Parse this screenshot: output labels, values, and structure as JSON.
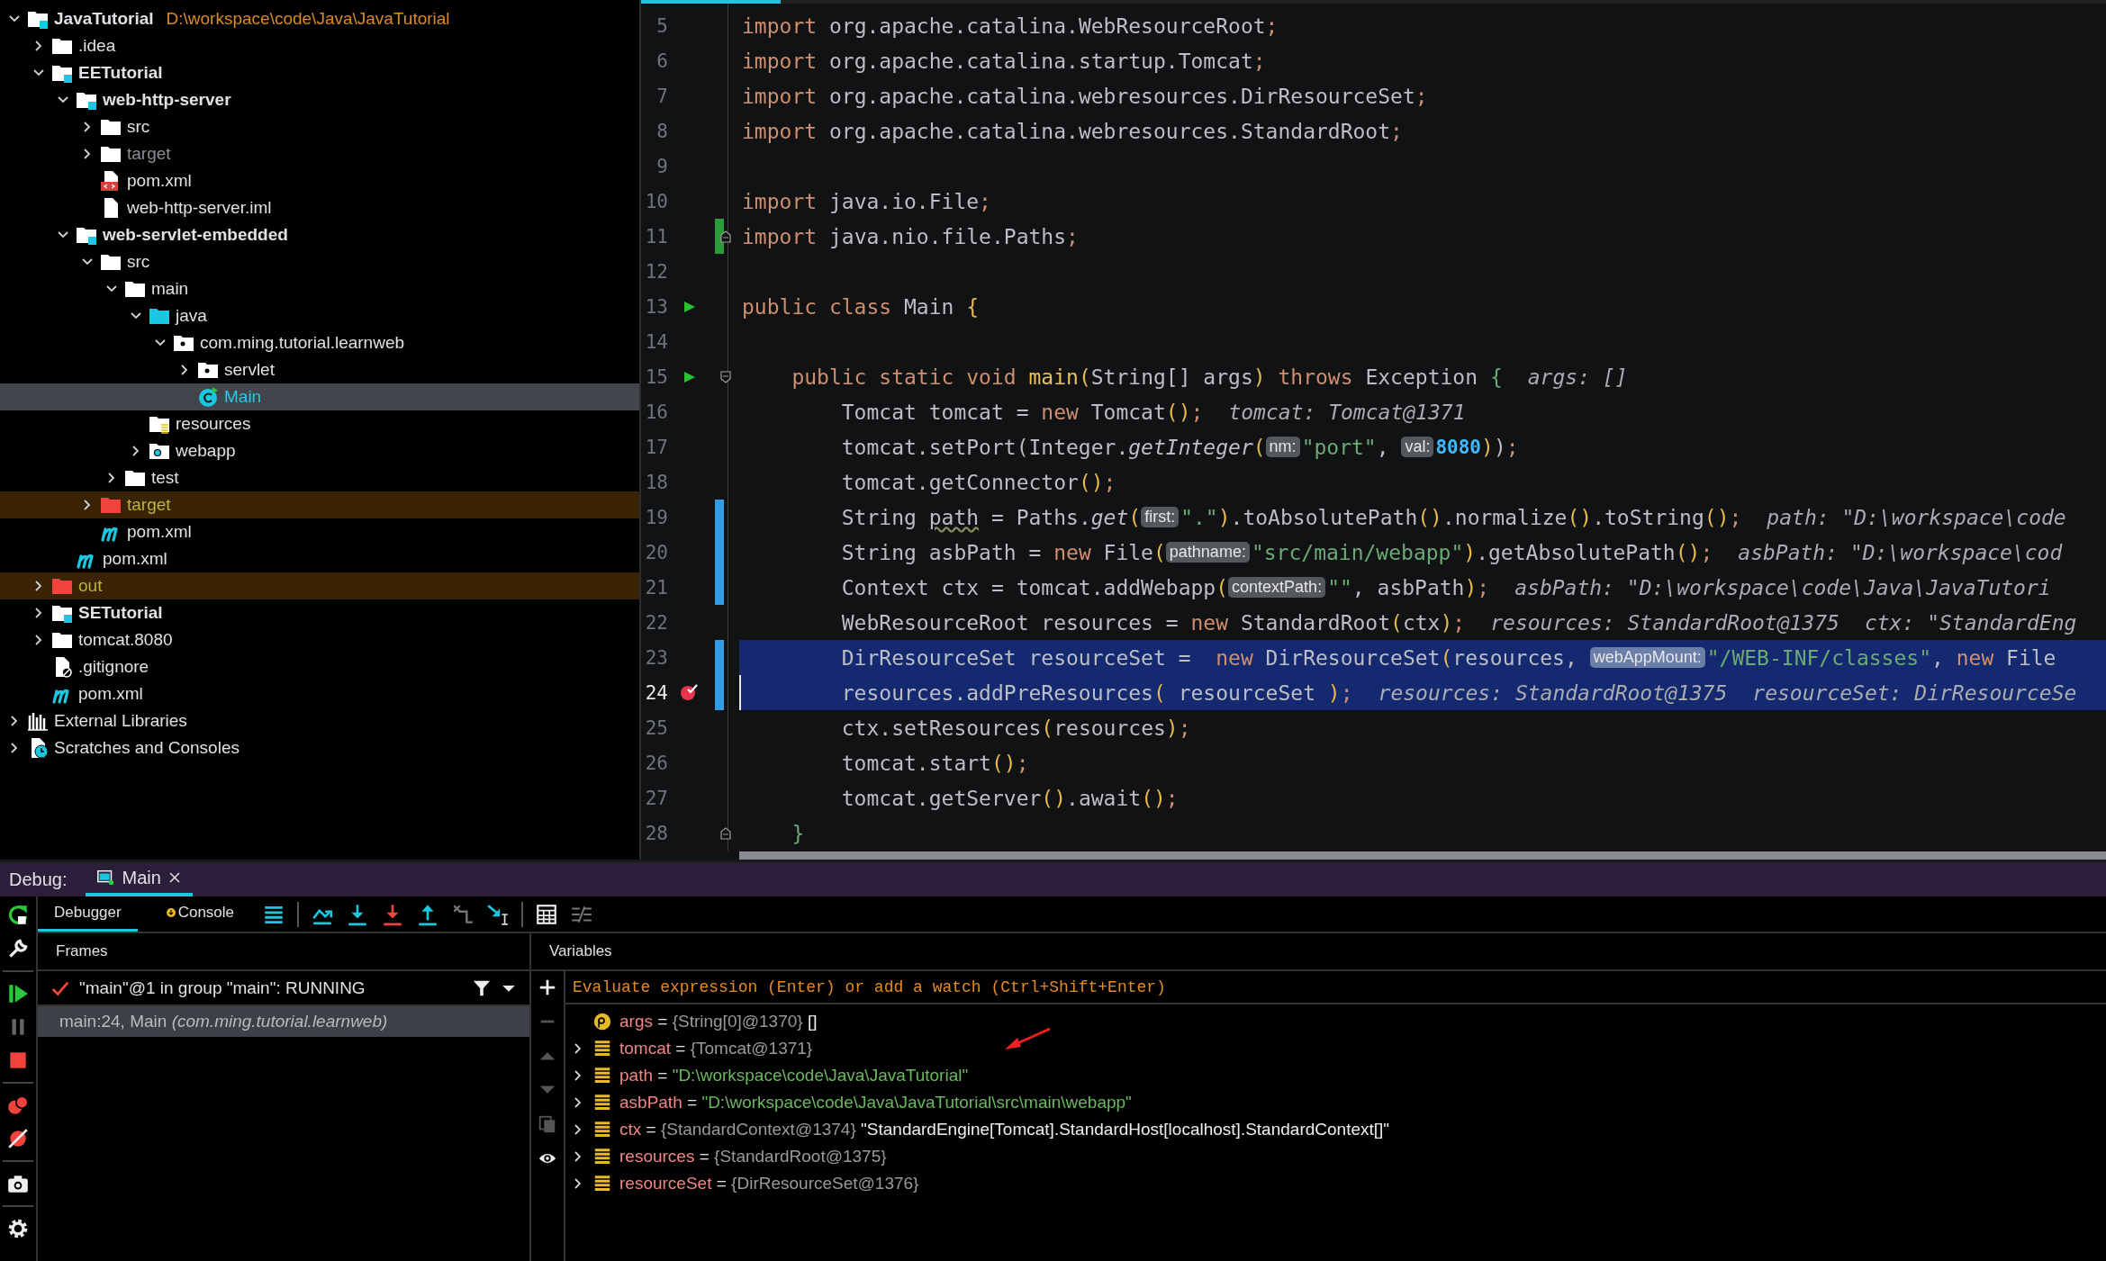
{
  "project": {
    "tree": [
      {
        "label": "JavaTutorial",
        "path": "D:\\workspace\\code\\Java\\JavaTutorial",
        "kind": "module",
        "expanded": true,
        "selected": false,
        "children": [
          {
            "label": ".idea",
            "kind": "folder",
            "expanded": false,
            "selected": false
          },
          {
            "label": "EETutorial",
            "kind": "module",
            "expanded": true,
            "selected": false,
            "children": [
              {
                "label": "web-http-server",
                "kind": "module",
                "expanded": true,
                "selected": false,
                "children": [
                  {
                    "label": "src",
                    "kind": "folder",
                    "expanded": false,
                    "selected": false
                  },
                  {
                    "label": "target",
                    "kind": "ignored-folder",
                    "expanded": false,
                    "selected": false
                  },
                  {
                    "label": "pom.xml",
                    "kind": "xml",
                    "selected": false
                  },
                  {
                    "label": "web-http-server.iml",
                    "kind": "iml",
                    "selected": false
                  }
                ]
              },
              {
                "label": "web-servlet-embedded",
                "kind": "module",
                "expanded": true,
                "selected": false,
                "children": [
                  {
                    "label": "src",
                    "kind": "folder",
                    "expanded": true,
                    "selected": false,
                    "children": [
                      {
                        "label": "main",
                        "kind": "folder",
                        "expanded": true,
                        "selected": false,
                        "children": [
                          {
                            "label": "java",
                            "kind": "source-folder",
                            "expanded": true,
                            "selected": false,
                            "children": [
                              {
                                "label": "com.ming.tutorial.learnweb",
                                "kind": "package",
                                "expanded": true,
                                "selected": false,
                                "children": [
                                  {
                                    "label": "servlet",
                                    "kind": "package",
                                    "expanded": false,
                                    "selected": false
                                  },
                                  {
                                    "label": "Main",
                                    "kind": "class",
                                    "selected": true
                                  }
                                ]
                              }
                            ]
                          },
                          {
                            "label": "resources",
                            "kind": "resources",
                            "selected": false
                          },
                          {
                            "label": "webapp",
                            "kind": "web-folder",
                            "expanded": false,
                            "selected": false
                          }
                        ]
                      },
                      {
                        "label": "test",
                        "kind": "folder",
                        "expanded": false,
                        "selected": false
                      }
                    ]
                  },
                  {
                    "label": "target",
                    "kind": "excluded-folder",
                    "expanded": false,
                    "selected": false
                  },
                  {
                    "label": "pom.xml",
                    "kind": "maven",
                    "selected": false
                  }
                ]
              },
              {
                "label": "pom.xml",
                "kind": "maven",
                "selected": false
              }
            ]
          },
          {
            "label": "out",
            "kind": "excluded-folder",
            "expanded": false,
            "selected": false
          },
          {
            "label": "SETutorial",
            "kind": "module",
            "expanded": false,
            "selected": false
          },
          {
            "label": "tomcat.8080",
            "kind": "folder",
            "expanded": false,
            "selected": false
          },
          {
            "label": ".gitignore",
            "kind": "gitignore",
            "selected": false
          },
          {
            "label": "pom.xml",
            "kind": "maven",
            "selected": false
          }
        ]
      },
      {
        "label": "External Libraries",
        "kind": "libraries",
        "expanded": false,
        "selected": false
      },
      {
        "label": "Scratches and Consoles",
        "kind": "scratches",
        "expanded": false,
        "selected": false
      }
    ]
  },
  "editor": {
    "lines": [
      {
        "number": "5",
        "highlighted": false,
        "current": false,
        "tokens": [
          {
            "kind": "kw",
            "text": "import"
          },
          {
            "kind": "id",
            "text": " org.apache.catalina.WebResourceRoot"
          },
          {
            "kind": "kw",
            "text": ";"
          }
        ]
      },
      {
        "number": "6",
        "highlighted": false,
        "current": false,
        "tokens": [
          {
            "kind": "kw",
            "text": "import"
          },
          {
            "kind": "id",
            "text": " org.apache.catalina.startup.Tomcat"
          },
          {
            "kind": "kw",
            "text": ";"
          }
        ]
      },
      {
        "number": "7",
        "highlighted": false,
        "current": false,
        "tokens": [
          {
            "kind": "kw",
            "text": "import"
          },
          {
            "kind": "id",
            "text": " org.apache.catalina.webresources.DirResourceSet"
          },
          {
            "kind": "kw",
            "text": ";"
          }
        ]
      },
      {
        "number": "8",
        "highlighted": false,
        "current": false,
        "tokens": [
          {
            "kind": "kw",
            "text": "import"
          },
          {
            "kind": "id",
            "text": " org.apache.catalina.webresources.StandardRoot"
          },
          {
            "kind": "kw",
            "text": ";"
          }
        ]
      },
      {
        "number": "9",
        "highlighted": false,
        "current": false
      },
      {
        "number": "10",
        "highlighted": false,
        "current": false,
        "tokens": [
          {
            "kind": "kw",
            "text": "import"
          },
          {
            "kind": "id",
            "text": " java.io.File"
          },
          {
            "kind": "kw",
            "text": ";"
          }
        ]
      },
      {
        "number": "11",
        "highlighted": false,
        "current": false,
        "change": {
          "color": "#2a9d3a"
        },
        "fold_end": true,
        "tokens": [
          {
            "kind": "kw",
            "text": "import"
          },
          {
            "kind": "id",
            "text": " java.nio.file.Paths"
          },
          {
            "kind": "kw",
            "text": ";"
          }
        ]
      },
      {
        "number": "12",
        "highlighted": false,
        "current": false
      },
      {
        "number": "13",
        "highlighted": false,
        "current": false,
        "run": true,
        "tokens": [
          {
            "kind": "kw",
            "text": "public class"
          },
          {
            "kind": "id",
            "text": " Main "
          },
          {
            "kind": "paren",
            "text": "{"
          }
        ]
      },
      {
        "number": "14",
        "highlighted": false,
        "current": false
      },
      {
        "number": "15",
        "highlighted": false,
        "current": false,
        "run": true,
        "fold_start": true,
        "tokens": [
          {
            "kind": "kw",
            "text": "    public static void "
          },
          {
            "kind": "fn",
            "text": "main"
          },
          {
            "kind": "paren",
            "text": "("
          },
          {
            "kind": "id",
            "text": "String[] args"
          },
          {
            "kind": "paren",
            "text": ")"
          },
          {
            "kind": "kw",
            "text": " throws "
          },
          {
            "kind": "id",
            "text": "Exception "
          },
          {
            "kind": "paren2",
            "text": "{"
          },
          {
            "kind": "value",
            "text": "args: []"
          }
        ]
      },
      {
        "number": "16",
        "highlighted": false,
        "current": false,
        "tokens": [
          {
            "kind": "id",
            "text": "        Tomcat tomcat = "
          },
          {
            "kind": "kw",
            "text": "new "
          },
          {
            "kind": "id",
            "text": "Tomcat"
          },
          {
            "kind": "paren",
            "text": "()"
          },
          {
            "kind": "kw",
            "text": ";"
          },
          {
            "kind": "value",
            "text": "tomcat: Tomcat@1371"
          }
        ]
      },
      {
        "number": "17",
        "highlighted": false,
        "current": false,
        "tokens": [
          {
            "kind": "id",
            "text": "        tomcat.setPort(Integer."
          },
          {
            "kind": "call",
            "text": "getInteger"
          },
          {
            "kind": "paren",
            "text": "("
          },
          {
            "kind": "hint",
            "text": "nm:"
          },
          {
            "kind": "str",
            "text": "\"port\""
          },
          {
            "kind": "id",
            "text": ", "
          },
          {
            "kind": "hint",
            "text": "val:"
          },
          {
            "kind": "num",
            "text": "8080"
          },
          {
            "kind": "paren",
            "text": ")"
          },
          {
            "kind": "id",
            "text": ")"
          },
          {
            "kind": "kw",
            "text": ";"
          }
        ]
      },
      {
        "number": "18",
        "highlighted": false,
        "current": false,
        "tokens": [
          {
            "kind": "id",
            "text": "        tomcat.getConnector"
          },
          {
            "kind": "paren",
            "text": "()"
          },
          {
            "kind": "kw",
            "text": ";"
          }
        ]
      },
      {
        "number": "19",
        "highlighted": false,
        "current": false,
        "change": {
          "color": "#2f9ce8"
        },
        "tokens": [
          {
            "kind": "id",
            "text": "        String "
          },
          {
            "kind": "warn",
            "text": "path"
          },
          {
            "kind": "id",
            "text": " = Paths."
          },
          {
            "kind": "call",
            "text": "get"
          },
          {
            "kind": "paren",
            "text": "("
          },
          {
            "kind": "hint",
            "text": "first:"
          },
          {
            "kind": "str",
            "text": "\".\""
          },
          {
            "kind": "paren",
            "text": ")"
          },
          {
            "kind": "id",
            "text": ".toAbsolutePath"
          },
          {
            "kind": "paren",
            "text": "()"
          },
          {
            "kind": "id",
            "text": ".normalize"
          },
          {
            "kind": "paren",
            "text": "()"
          },
          {
            "kind": "id",
            "text": ".toString"
          },
          {
            "kind": "paren",
            "text": "()"
          },
          {
            "kind": "kw",
            "text": ";"
          },
          {
            "kind": "value",
            "text": "path: \"D:\\workspace\\code"
          }
        ]
      },
      {
        "number": "20",
        "highlighted": false,
        "current": false,
        "change": {
          "color": "#2f9ce8"
        },
        "tokens": [
          {
            "kind": "id",
            "text": "        String asbPath = "
          },
          {
            "kind": "kw",
            "text": "new "
          },
          {
            "kind": "id",
            "text": "File"
          },
          {
            "kind": "paren",
            "text": "("
          },
          {
            "kind": "hint",
            "text": "pathname:"
          },
          {
            "kind": "str",
            "text": "\"src/main/webapp\""
          },
          {
            "kind": "paren",
            "text": ")"
          },
          {
            "kind": "id",
            "text": ".getAbsolutePath"
          },
          {
            "kind": "paren",
            "text": "()"
          },
          {
            "kind": "kw",
            "text": ";"
          },
          {
            "kind": "value",
            "text": "asbPath: \"D:\\workspace\\cod"
          }
        ]
      },
      {
        "number": "21",
        "highlighted": false,
        "current": false,
        "change": {
          "color": "#2f9ce8"
        },
        "tokens": [
          {
            "kind": "id",
            "text": "        Context ctx = tomcat.addWebapp"
          },
          {
            "kind": "paren",
            "text": "("
          },
          {
            "kind": "hint",
            "text": "contextPath:"
          },
          {
            "kind": "str",
            "text": "\"\""
          },
          {
            "kind": "id",
            "text": ", asbPath"
          },
          {
            "kind": "paren",
            "text": ")"
          },
          {
            "kind": "kw",
            "text": ";"
          },
          {
            "kind": "value",
            "text": "asbPath: \"D:\\workspace\\code\\Java\\JavaTutori"
          }
        ]
      },
      {
        "number": "22",
        "highlighted": false,
        "current": false,
        "tokens": [
          {
            "kind": "id",
            "text": "        WebResourceRoot resources = "
          },
          {
            "kind": "kw",
            "text": "new "
          },
          {
            "kind": "id",
            "text": "StandardRoot"
          },
          {
            "kind": "paren",
            "text": "("
          },
          {
            "kind": "id",
            "text": "ctx"
          },
          {
            "kind": "paren",
            "text": ")"
          },
          {
            "kind": "kw",
            "text": ";"
          },
          {
            "kind": "value",
            "text": "resources: StandardRoot@1375"
          },
          {
            "kind": "value",
            "text": "ctx: \"StandardEng"
          }
        ]
      },
      {
        "number": "23",
        "highlighted": true,
        "current": false,
        "change": {
          "color": "#2f9ce8"
        },
        "tokens": [
          {
            "kind": "id",
            "text": "        DirResourceSet resourceSet =  "
          },
          {
            "kind": "kw",
            "text": "new "
          },
          {
            "kind": "id",
            "text": "DirResourceSet"
          },
          {
            "kind": "paren",
            "text": "("
          },
          {
            "kind": "id",
            "text": "resources, "
          },
          {
            "kind": "hint",
            "text": "webAppMount:"
          },
          {
            "kind": "str",
            "text": "\"/WEB-INF/classes\""
          },
          {
            "kind": "id",
            "text": ", "
          },
          {
            "kind": "kw",
            "text": "new "
          },
          {
            "kind": "id",
            "text": "File"
          }
        ]
      },
      {
        "number": "24",
        "highlighted": true,
        "current": true,
        "change": {
          "color": "#2f9ce8"
        },
        "breakpoint": true,
        "tokens": [
          {
            "kind": "id",
            "text": "        resources.addPreResources"
          },
          {
            "kind": "paren",
            "text": "("
          },
          {
            "kind": "id",
            "text": " resourceSet "
          },
          {
            "kind": "paren",
            "text": ")"
          },
          {
            "kind": "kw",
            "text": ";"
          },
          {
            "kind": "value",
            "text": "resources: StandardRoot@1375"
          },
          {
            "kind": "value",
            "text": "resourceSet: DirResourceSe"
          }
        ]
      },
      {
        "number": "25",
        "highlighted": false,
        "current": false,
        "tokens": [
          {
            "kind": "id",
            "text": "        ctx.setResources"
          },
          {
            "kind": "paren",
            "text": "("
          },
          {
            "kind": "id",
            "text": "resources"
          },
          {
            "kind": "paren",
            "text": ")"
          },
          {
            "kind": "kw",
            "text": ";"
          }
        ]
      },
      {
        "number": "26",
        "highlighted": false,
        "current": false,
        "tokens": [
          {
            "kind": "id",
            "text": "        tomcat.start"
          },
          {
            "kind": "paren",
            "text": "()"
          },
          {
            "kind": "kw",
            "text": ";"
          }
        ]
      },
      {
        "number": "27",
        "highlighted": false,
        "current": false,
        "tokens": [
          {
            "kind": "id",
            "text": "        tomcat.getServer"
          },
          {
            "kind": "paren",
            "text": "()"
          },
          {
            "kind": "id",
            "text": ".await"
          },
          {
            "kind": "paren",
            "text": "()"
          },
          {
            "kind": "kw",
            "text": ";"
          }
        ]
      },
      {
        "number": "28",
        "highlighted": false,
        "current": false,
        "fold_end": true,
        "tokens": [
          {
            "kind": "paren2",
            "text": "    }"
          }
        ]
      }
    ]
  },
  "debug": {
    "title": "Debug:",
    "tabs": [
      {
        "label": "Main",
        "selected": true
      }
    ],
    "subtabs": [
      {
        "label": "Debugger",
        "selected": true
      },
      {
        "label": "Console",
        "selected": false
      }
    ],
    "frames": {
      "title": "Frames",
      "thread": "\"main\"@1 in group \"main\": RUNNING",
      "items": [
        {
          "method": "main:24, Main",
          "package": "(com.ming.tutorial.learnweb)",
          "selected": true
        }
      ]
    },
    "variables": {
      "title": "Variables",
      "placeholder": "Evaluate expression (Enter) or add a watch (Ctrl+Shift+Enter)",
      "items": [
        {
          "kind": "param",
          "name": "args",
          "sep": "=",
          "value": [
            {
              "kind": "ref",
              "text": "{String[0]@1370}"
            },
            {
              "kind": "plain",
              "text": "[]"
            }
          ]
        },
        {
          "kind": "field",
          "name": "tomcat",
          "sep": "=",
          "value": [
            {
              "kind": "ref",
              "text": "{Tomcat@1371}"
            }
          ]
        },
        {
          "kind": "field",
          "name": "path",
          "sep": "=",
          "value": [
            {
              "kind": "string",
              "text": "\"D:\\workspace\\code\\Java\\JavaTutorial\""
            }
          ]
        },
        {
          "kind": "field",
          "name": "asbPath",
          "sep": "=",
          "value": [
            {
              "kind": "string",
              "text": "\"D:\\workspace\\code\\Java\\JavaTutorial\\src\\main\\webapp\""
            }
          ]
        },
        {
          "kind": "field",
          "name": "ctx",
          "sep": "=",
          "value": [
            {
              "kind": "ref",
              "text": "{StandardContext@1374}"
            },
            {
              "kind": "plain",
              "text": "\"StandardEngine[Tomcat].StandardHost[localhost].StandardContext[]\""
            }
          ]
        },
        {
          "kind": "field",
          "name": "resources",
          "sep": "=",
          "value": [
            {
              "kind": "ref",
              "text": "{StandardRoot@1375}"
            }
          ]
        },
        {
          "kind": "field",
          "name": "resourceSet",
          "sep": "=",
          "value": [
            {
              "kind": "ref",
              "text": "{DirResourceSet@1376}"
            }
          ]
        }
      ]
    }
  }
}
